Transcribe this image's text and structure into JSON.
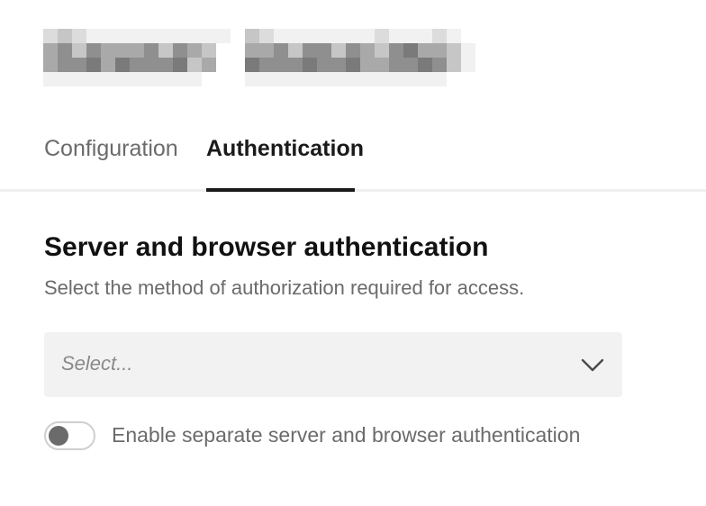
{
  "header": {
    "title_redacted": true
  },
  "tabs": [
    {
      "label": "Configuration",
      "active": false
    },
    {
      "label": "Authentication",
      "active": true
    }
  ],
  "section": {
    "title": "Server and browser authentication",
    "description": "Select the method of authorization required for access."
  },
  "auth_method_select": {
    "placeholder": "Select...",
    "icon": "chevron-down-icon"
  },
  "separate_auth_toggle": {
    "label": "Enable separate server and browser authentication",
    "enabled": false
  },
  "colors": {
    "active_tab": "#1a1a1a",
    "inactive_text": "#6b6b6b",
    "select_background": "#f2f2f2",
    "toggle_knob": "#6b6b6b"
  }
}
